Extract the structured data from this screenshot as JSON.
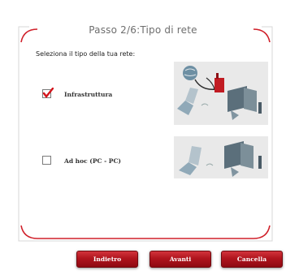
{
  "dialog": {
    "title": "Passo 2/6:Tipo di rete",
    "subtitle": "Seleziona il tipo della tua rete:"
  },
  "options": [
    {
      "label": "Infrastruttura",
      "checked": true,
      "illustration": "router-laptop-desktop-illustration"
    },
    {
      "label": "Ad hoc (PC - PC)",
      "checked": false,
      "illustration": "laptop-desktop-illustration"
    }
  ],
  "buttons": {
    "back": "Indietro",
    "next": "Avanti",
    "cancel": "Cancella"
  },
  "colors": {
    "accent": "#c8102e",
    "check": "#d4141c"
  }
}
